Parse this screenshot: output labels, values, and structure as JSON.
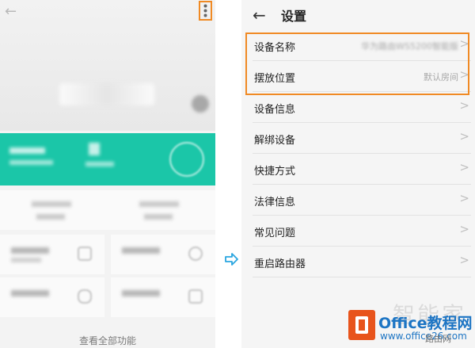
{
  "left_screen": {
    "view_all_label": "查看全部功能"
  },
  "settings": {
    "title": "设置",
    "rows": [
      {
        "label": "设备名称",
        "value": "华为路由WS5200智能版"
      },
      {
        "label": "摆放位置",
        "value": "默认房间"
      },
      {
        "label": "设备信息",
        "value": ""
      },
      {
        "label": "解绑设备",
        "value": ""
      },
      {
        "label": "快捷方式",
        "value": ""
      },
      {
        "label": "法律信息",
        "value": ""
      },
      {
        "label": "常见问题",
        "value": ""
      },
      {
        "label": "重启路由器",
        "value": ""
      }
    ]
  },
  "watermark": {
    "zhi": "智能家",
    "brand": "Office教程网",
    "url": "www.office26.com",
    "tag": "路由网"
  },
  "icons": {
    "back": "back-arrow-icon",
    "more": "more-vertical-icon",
    "chevron": "chevron-right-icon",
    "between": "right-arrow-icon"
  },
  "colors": {
    "accent": "#f08a24",
    "teal": "#1bc6a8",
    "brand": "#1d75c4"
  }
}
